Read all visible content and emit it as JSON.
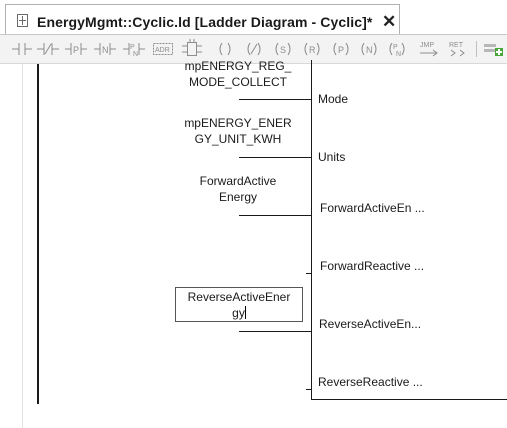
{
  "tab": {
    "title": "EnergyMgmt::Cyclic.ld [Ladder Diagram - Cyclic]*",
    "close": "✕"
  },
  "toolbar": {
    "icons": [
      "contact-no-icon",
      "contact-nc-icon",
      "contact-p-icon",
      "contact-n-icon",
      "contact-p-n-icon",
      "address-icon",
      "block-icon",
      "coil-icon",
      "coil-negated-icon",
      "coil-set-icon",
      "coil-reset-icon",
      "coil-p-icon",
      "coil-n-icon",
      "coil-pn-icon",
      "jump-icon",
      "return-icon",
      "add-network-icon"
    ],
    "adr_label": "ADR",
    "jmp_label": "JMP",
    "ret_label": "RET",
    "p_label": "P",
    "n_label": "N",
    "s_label": "S",
    "r_label": "R"
  },
  "ladder": {
    "inputs": [
      {
        "variable_line1": "mpENERGY_REG_",
        "variable_line2": "MODE_COLLECT",
        "pin": "Mode"
      },
      {
        "variable_line1": "mpENERGY_ENER",
        "variable_line2": "GY_UNIT_KWH",
        "pin": "Units"
      },
      {
        "variable_line1": "ForwardActive",
        "variable_line2": "Energy",
        "pin": "ForwardActiveEn ..."
      },
      {
        "variable_line1": "",
        "variable_line2": "",
        "pin": "ForwardReactive ..."
      },
      {
        "variable_line1": "ReverseActiveEner",
        "variable_line2": "gy",
        "pin": "ReverseActiveEn..."
      },
      {
        "variable_line1": "",
        "variable_line2": "",
        "pin": "ReverseReactive ..."
      }
    ]
  },
  "colors": {
    "toolbar_icon": "#8d8d8d",
    "wire": "#1a1a1a",
    "tab_border": "#b0b0b0"
  }
}
